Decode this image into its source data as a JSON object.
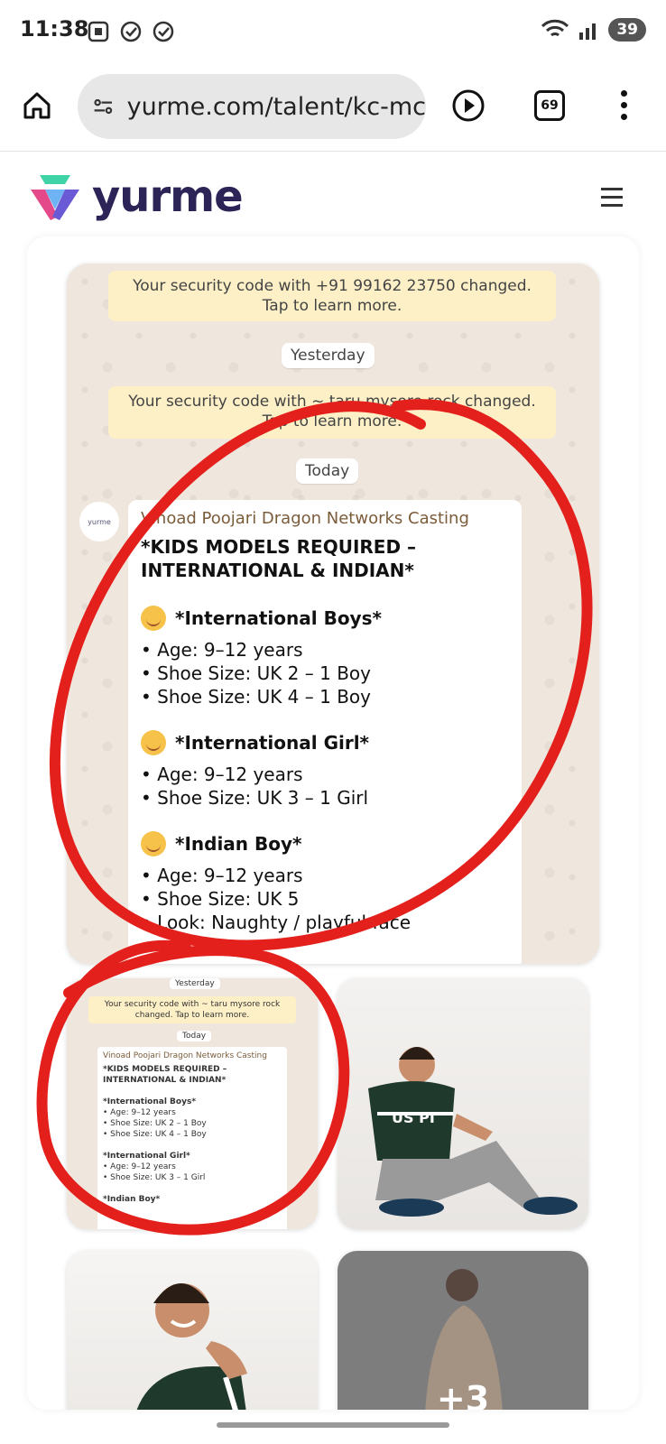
{
  "status_bar": {
    "time": "11:38",
    "battery": "39"
  },
  "browser": {
    "url": "yurme.com/talent/kc-mc",
    "tab_count": "69"
  },
  "site": {
    "brand": "yurme"
  },
  "chat": {
    "security_msg_1": "Your security code with +91 99162 23750 changed. Tap to learn more.",
    "date_1": "Yesterday",
    "security_msg_2": "Your security code with ~ taru mysore rock changed. Tap to learn more.",
    "date_2": "Today",
    "avatar_label": "yurme",
    "sender": "Vinoad Poojari Dragon Networks Casting",
    "title": "*KIDS MODELS REQUIRED – INTERNATIONAL & INDIAN*",
    "sec1": "*International Boys*",
    "sec1_l1": "• Age: 9–12 years",
    "sec1_l2": "• Shoe Size: UK 2 – 1 Boy",
    "sec1_l3": "• Shoe Size: UK 4 – 1 Boy",
    "sec2": "*International Girl*",
    "sec2_l1": "• Age: 9–12 years",
    "sec2_l2": "• Shoe Size: UK 3 – 1 Girl",
    "sec3": "*Indian Boy*",
    "sec3_l1": "• Age: 9–12 years",
    "sec3_l2": "• Shoe Size: UK 5",
    "sec3_l3": "• Look: Naughty / playful face"
  },
  "thumb1": {
    "date_1": "Yesterday",
    "security_msg": "Your security code with ~ taru mysore rock changed. Tap to learn more.",
    "date_2": "Today",
    "sender": "Vinoad Poojari Dragon Networks Casting",
    "title": "*KIDS MODELS REQUIRED – INTERNATIONAL & INDIAN*",
    "sec1": "*International Boys*",
    "l1": "• Age: 9–12 years",
    "l2": "• Shoe Size: UK 2 – 1 Boy",
    "l3": "• Shoe Size: UK 4 – 1 Boy",
    "sec2": "*International Girl*",
    "l4": "• Age: 9–12 years",
    "l5": "• Shoe Size: UK 3 – 1 Girl",
    "sec3": "*Indian Boy*"
  },
  "photo_shirt_text": "US PI",
  "more_count": "+3",
  "colors": {
    "annotation": "#e3201b",
    "brand_dark": "#2c2456"
  }
}
